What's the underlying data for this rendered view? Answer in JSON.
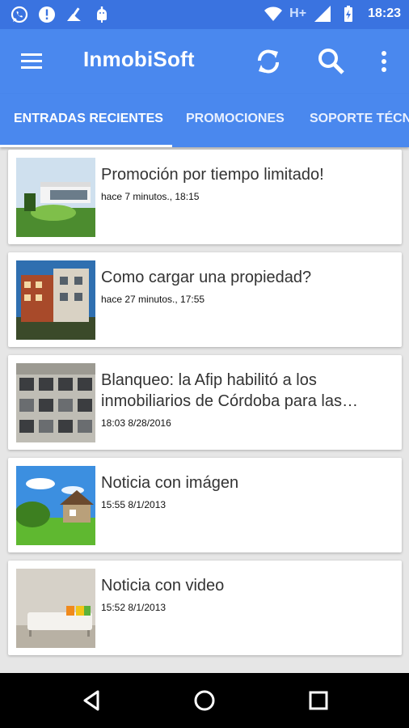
{
  "status_bar": {
    "network_type": "H+",
    "time": "18:23"
  },
  "app_bar": {
    "title": "InmobiSoft",
    "icons": [
      "menu-icon",
      "refresh-icon",
      "search-icon",
      "more-vert-icon"
    ]
  },
  "tabs": [
    {
      "label": "ENTRADAS RECIENTES",
      "active": true
    },
    {
      "label": "PROMOCIONES",
      "active": false
    },
    {
      "label": "SOPORTE TÉCN",
      "active": false
    }
  ],
  "posts": [
    {
      "title": "Promoción por tiempo limitado!",
      "meta": "hace 7 minutos., 18:15"
    },
    {
      "title": "Como cargar una propiedad?",
      "meta": "hace 27 minutos., 17:55"
    },
    {
      "title": "Blanqueo: la Afip habilitó a los inmobiliarios de Córdoba para las…",
      "meta": "18:03 8/28/2016"
    },
    {
      "title": "Noticia con imágen",
      "meta": "15:55 8/1/2013"
    },
    {
      "title": "Noticia con video",
      "meta": "15:52 8/1/2013"
    }
  ],
  "colors": {
    "status_bar": "#3a73e0",
    "app_bar": "#4a88ee",
    "background": "#e6e6e6"
  }
}
